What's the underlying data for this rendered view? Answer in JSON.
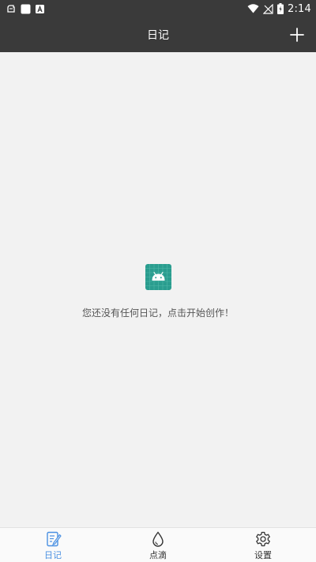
{
  "status_bar": {
    "time": "2:14",
    "icons": [
      "notification-icon",
      "square-icon",
      "a-icon",
      "wifi-icon",
      "signal-icon",
      "battery-icon"
    ]
  },
  "app_bar": {
    "title": "日记",
    "add_icon": "plus-icon"
  },
  "main": {
    "empty_icon": "android-app-icon",
    "empty_message": "您还没有任何日记，点击开始创作！"
  },
  "bottom_nav": {
    "items": [
      {
        "label": "日记",
        "icon": "diary-icon",
        "active": true
      },
      {
        "label": "点滴",
        "icon": "drop-icon",
        "active": false
      },
      {
        "label": "设置",
        "icon": "gear-icon",
        "active": false
      }
    ]
  },
  "colors": {
    "bar_background": "#3a3a3a",
    "content_background": "#f2f2f2",
    "accent": "#4a90e2",
    "logo_teal": "#2a9d8f"
  }
}
